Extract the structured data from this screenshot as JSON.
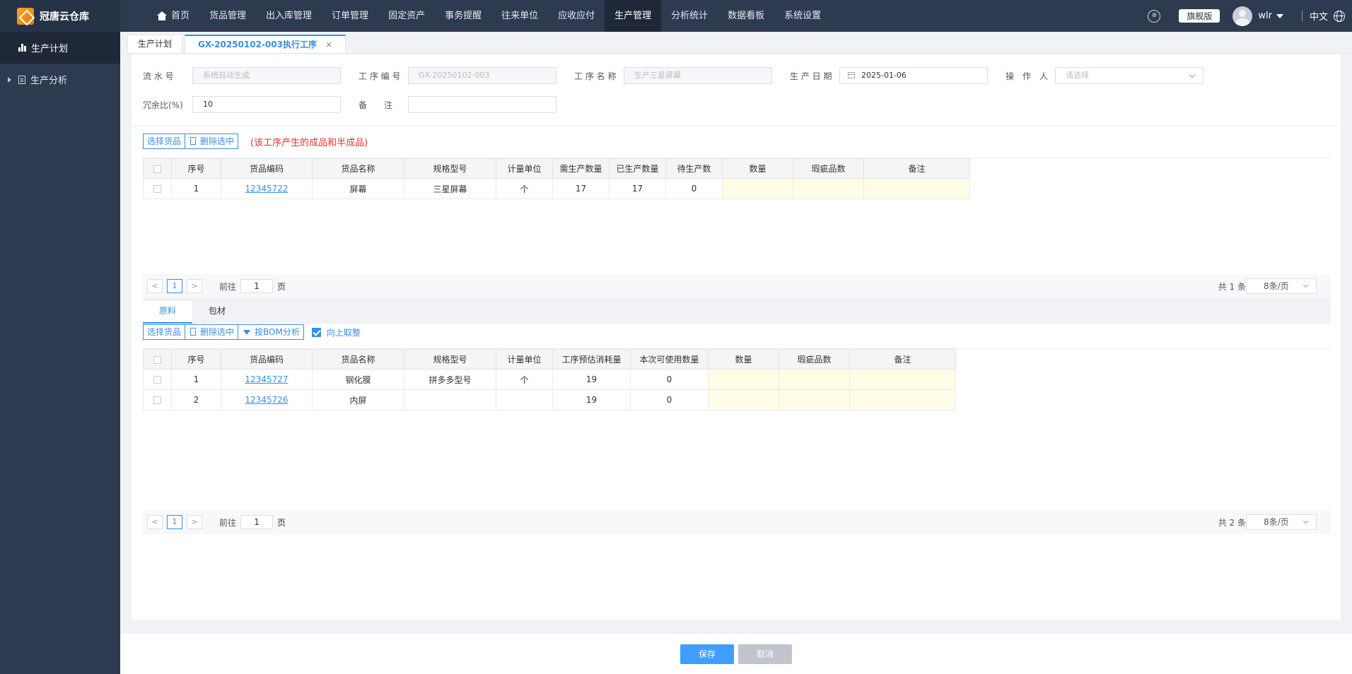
{
  "app": {
    "logo_text": "冠唐云仓库"
  },
  "nav": {
    "home": "首页",
    "items": [
      "货品管理",
      "出入库管理",
      "订单管理",
      "固定资产",
      "事务提醒",
      "往来单位",
      "应收应付",
      "生产管理",
      "分析统计",
      "数据看板",
      "系统设置"
    ],
    "active": "生产管理"
  },
  "header_right": {
    "edition": "旗舰版",
    "username": "wlr",
    "language": "中文"
  },
  "sidebar": {
    "items": [
      "生产计划",
      "生产分析"
    ]
  },
  "tabs": {
    "items": [
      "生产计划",
      "GX-20250102-003执行工序"
    ],
    "close": "×"
  },
  "form": {
    "serial_label": "流 水 号",
    "serial_placeholder": "系统自动生成",
    "process_no_label": "工 序 编 号",
    "process_no_value": "GX-20250102-003",
    "process_name_label": "工 序 名 称",
    "process_name_value": "生产三星屏幕",
    "date_label": "生 产 日 期",
    "date_value": "2025-01-06",
    "operator_label": "操　作　人",
    "operator_placeholder": "请选择",
    "redundancy_label": "冗余比(%)",
    "redundancy_value": "10",
    "remark_label": "备　　注",
    "remark_value": ""
  },
  "products": {
    "select_btn": "选择货品",
    "delete_btn": "删除选中",
    "note": "(该工序产生的成品和半成品)",
    "headers": [
      "序号",
      "货品编码",
      "货品名称",
      "规格型号",
      "计量单位",
      "需生产数量",
      "已生产数量",
      "待生产数",
      "数量",
      "瑕疵品数",
      "备注"
    ],
    "rows": [
      [
        "1",
        "12345722",
        "屏幕",
        "三星屏幕",
        "个",
        "17",
        "17",
        "0",
        "",
        "",
        ""
      ]
    ],
    "pager": {
      "prev": "<",
      "page": "1",
      "next": ">",
      "goto_prefix": "前往",
      "goto_value": "1",
      "goto_suffix": "页",
      "total": "共 1 条",
      "size": "8条/页"
    }
  },
  "materials": {
    "tabs": [
      "原料",
      "包材"
    ],
    "select_btn": "选择货品",
    "delete_btn": "删除选中",
    "bom_btn": "按BOM分析",
    "roundup_label": "向上取整",
    "headers": [
      "序号",
      "货品编码",
      "货品名称",
      "规格型号",
      "计量单位",
      "工序预估消耗量",
      "本次可使用数量",
      "数量",
      "瑕疵品数",
      "备注"
    ],
    "rows": [
      [
        "1",
        "12345727",
        "钢化膜",
        "拼多多型号",
        "个",
        "19",
        "0",
        "",
        "",
        ""
      ],
      [
        "2",
        "12345726",
        "内屏",
        "",
        "",
        "19",
        "0",
        "",
        "",
        ""
      ]
    ],
    "pager": {
      "prev": "<",
      "page": "1",
      "next": ">",
      "goto_prefix": "前往",
      "goto_value": "1",
      "goto_suffix": "页",
      "total": "共 2 条",
      "size": "8条/页"
    }
  },
  "footer": {
    "save": "保存",
    "cancel": "取消"
  }
}
